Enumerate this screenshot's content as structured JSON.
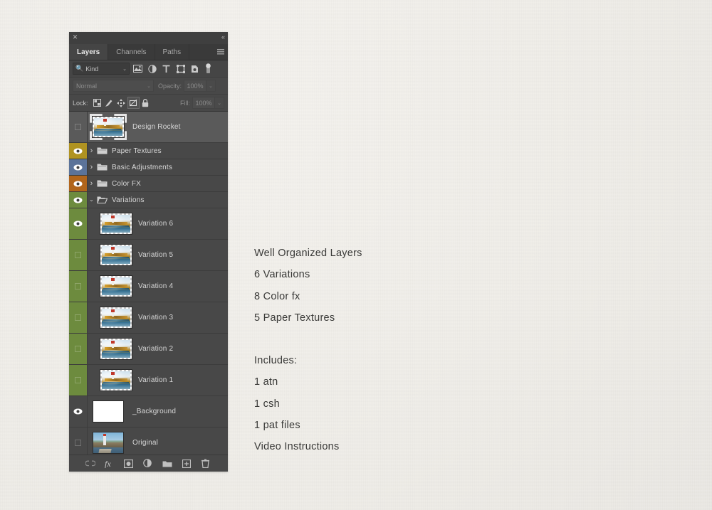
{
  "panel": {
    "window": {
      "close_icon": "close-icon",
      "collapse_icon": "collapse-icon",
      "close_glyph": "✕",
      "collapse_glyph": "«"
    },
    "tabs": [
      {
        "label": "Layers",
        "active": true
      },
      {
        "label": "Channels",
        "active": false
      },
      {
        "label": "Paths",
        "active": false
      }
    ],
    "panel_menu_icon": "panel-menu-icon",
    "filter": {
      "search_icon": "search-icon",
      "kind_label": "Kind",
      "kind_chevron": "⌄",
      "type_filters": [
        "pixel-layer-filter-icon",
        "adjustment-layer-filter-icon",
        "type-layer-filter-icon",
        "shape-layer-filter-icon",
        "smart-object-filter-icon"
      ],
      "filter_toggle_icon": "filter-toggle-switch"
    },
    "blend": {
      "mode": "Normal",
      "mode_chevron": "⌄",
      "opacity_label": "Opacity:",
      "opacity_value": "100%",
      "opacity_chevron": "⌄"
    },
    "lock": {
      "label": "Lock:",
      "icons": [
        "lock-transparent-pixels-icon",
        "lock-image-pixels-icon",
        "lock-position-icon",
        "lock-artboard-nesting-icon",
        "lock-all-icon"
      ],
      "fill_label": "Fill:",
      "fill_value": "100%",
      "fill_chevron": "⌄"
    },
    "layers": [
      {
        "name": "Design Rocket",
        "visible": false,
        "selected": true,
        "kind": "layer",
        "thumb": "paint",
        "color": null,
        "tall": true
      },
      {
        "name": "Paper Textures",
        "visible": true,
        "selected": false,
        "kind": "group",
        "expanded": false,
        "color": "#b09321"
      },
      {
        "name": "Basic Adjustments",
        "visible": true,
        "selected": false,
        "kind": "group",
        "expanded": false,
        "color": "#5b7399"
      },
      {
        "name": "Color FX",
        "visible": true,
        "selected": false,
        "kind": "group",
        "expanded": false,
        "color": "#b1651b"
      },
      {
        "name": "Variations",
        "visible": true,
        "selected": false,
        "kind": "group",
        "expanded": true,
        "color": "#6d8b3e"
      },
      {
        "name": "Variation 6",
        "visible": true,
        "selected": false,
        "kind": "child",
        "thumb": "paint",
        "color": "#6d8b3e",
        "tall": true
      },
      {
        "name": "Variation 5",
        "visible": false,
        "selected": false,
        "kind": "child",
        "thumb": "paint",
        "color": "#6d8b3e",
        "tall": true
      },
      {
        "name": "Variation 4",
        "visible": false,
        "selected": false,
        "kind": "child",
        "thumb": "paint",
        "color": "#6d8b3e",
        "tall": true
      },
      {
        "name": "Variation 3",
        "visible": false,
        "selected": false,
        "kind": "child",
        "thumb": "paint",
        "color": "#6d8b3e",
        "tall": true
      },
      {
        "name": "Variation 2",
        "visible": false,
        "selected": false,
        "kind": "child",
        "thumb": "paint",
        "color": "#6d8b3e",
        "tall": true
      },
      {
        "name": "Variation 1",
        "visible": false,
        "selected": false,
        "kind": "child",
        "thumb": "paint",
        "color": "#6d8b3e",
        "tall": true
      },
      {
        "name": "_Background",
        "visible": true,
        "selected": false,
        "kind": "layer",
        "thumb": "white",
        "color": null,
        "tall": true
      },
      {
        "name": "Original",
        "visible": false,
        "selected": false,
        "kind": "layer",
        "thumb": "photo",
        "color": null,
        "tall": true
      }
    ],
    "bottom_bar_icons": [
      "link-layers-icon",
      "add-layer-style-fx-icon",
      "add-layer-mask-icon",
      "new-adjustment-layer-icon",
      "new-group-icon",
      "new-layer-icon",
      "delete-layer-icon"
    ]
  },
  "copy": {
    "features": [
      "Well Organized Layers",
      "6 Variations",
      "8 Color fx",
      "5 Paper Textures"
    ],
    "includes_heading": "Includes:",
    "includes": [
      "1 atn",
      "1 csh",
      "1 pat files",
      "Video Instructions"
    ]
  },
  "colors": {
    "page_background": "#f1efeb",
    "panel_background": "#454545",
    "row_background": "#484848",
    "row_selected": "#5a5a5a",
    "text": "#d8d8d8",
    "copy_text": "#3a3a38"
  }
}
